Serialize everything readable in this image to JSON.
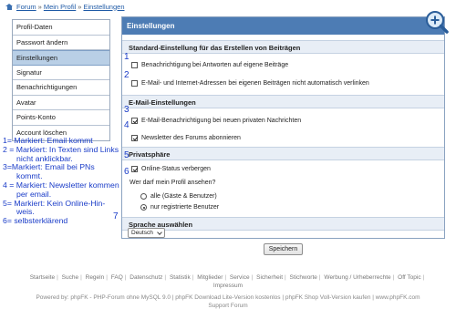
{
  "breadcrumb": {
    "items": [
      "Forum",
      "Mein Profil",
      "Einstellungen"
    ],
    "sep": "»"
  },
  "sidebar": {
    "items": [
      {
        "label": "Profil-Daten"
      },
      {
        "label": "Passwort ändern"
      },
      {
        "label": "Einstellungen",
        "active": true
      },
      {
        "label": "Signatur"
      },
      {
        "label": "Benachrichtigungen"
      },
      {
        "label": "Avatar"
      },
      {
        "label": "Points-Konto"
      },
      {
        "label": "Account löschen"
      }
    ]
  },
  "panel": {
    "title": "Einstellungen",
    "sections": {
      "standard": {
        "title": "Standard-Einstellung für das Erstellen von Beiträgen",
        "opt1": {
          "label": "Benachrichtigung bei Antworten auf eigene Beiträge",
          "checked": false
        },
        "opt2": {
          "label": "E-Mail- und Internet-Adressen bei eigenen Beiträgen nicht automatisch verlinken",
          "checked": false
        }
      },
      "email": {
        "title": "E-Mail-Einstellungen",
        "opt3": {
          "label": "E-Mail-Benachrichtigung bei neuen privaten Nachrichten",
          "checked": true
        },
        "opt4": {
          "label": "Newsletter des Forums abonnieren",
          "checked": true
        }
      },
      "privacy": {
        "title": "Privatsphäre",
        "opt5": {
          "label": "Online-Status verbergen",
          "checked": true
        },
        "question": "Wer darf mein Profil ansehen?",
        "radio1": {
          "label": "alle (Gäste & Benutzer)",
          "checked": false
        },
        "radio2": {
          "label": "nur registrierte Benutzer",
          "checked": true
        }
      },
      "language": {
        "title": "Sprache auswählen",
        "selected": "Deutsch"
      }
    },
    "save_label": "Speichern"
  },
  "annotations": {
    "numbers": [
      "1",
      "2",
      "3",
      "4",
      "5",
      "6",
      "7"
    ],
    "legend": [
      "1= Markiert: Email kommt",
      "2 = Markiert: In Texten sind Links",
      "nicht anklickbar.",
      "3=Markiert: Email bei PNs",
      "kommt.",
      "4 = Markiert: Newsletter kommen",
      "per email.",
      "5= Markiert: Kein Online-Hin-",
      "weis.",
      "6= selbsterklärend"
    ]
  },
  "footer": {
    "links": [
      "Startseite",
      "Suche",
      "Regeln",
      "FAQ",
      "Datenschutz",
      "Statistik",
      "Mitglieder",
      "Service",
      "Sicherheit",
      "Stichworte",
      "Werbung / Urheberrechte",
      "Off Topic",
      "Impressum"
    ],
    "powered_line1": "Powered by: phpFK - PHP-Forum ohne MySQL 9.0 | phpFK Download Lite-Version kostenlos | phpFK Shop Voll-Version kaufen | www.phpFK.com",
    "powered_line2": "Support Forum"
  },
  "colors": {
    "header_blue": "#4d7cb4",
    "annotation_blue": "#1a3cc8",
    "sidebar_active": "#b9cfe6"
  }
}
